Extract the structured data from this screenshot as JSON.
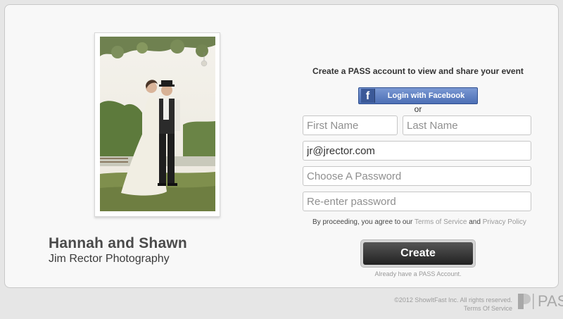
{
  "event": {
    "title": "Hannah and Shawn",
    "photographer": "Jim Rector Photography",
    "photo": "couple-wedding-photo"
  },
  "signup": {
    "heading": "Create a PASS account to view and share your event",
    "facebook_label": "Login with Facebook",
    "facebook_icon": "f",
    "or_label": "or",
    "first_name_placeholder": "First Name",
    "last_name_placeholder": "Last Name",
    "email_value": "jr@jrector.com",
    "password_placeholder": "Choose A Password",
    "password_confirm_placeholder": "Re-enter password",
    "agree_prefix": "By proceeding, you agree to our ",
    "terms_link": "Terms of Service",
    "agree_and": " and ",
    "privacy_link": "Privacy Policy",
    "create_label": "Create",
    "already_label": "Already have a PASS Account."
  },
  "footer": {
    "copyright": "©2012 ShowItFast Inc. All rights reserved.",
    "terms": "Terms Of Service",
    "logo_text": "PASS"
  },
  "colors": {
    "facebook_blue": "#4d6fb5",
    "create_dark": "#222222",
    "link_gray": "#9a9a9a"
  }
}
